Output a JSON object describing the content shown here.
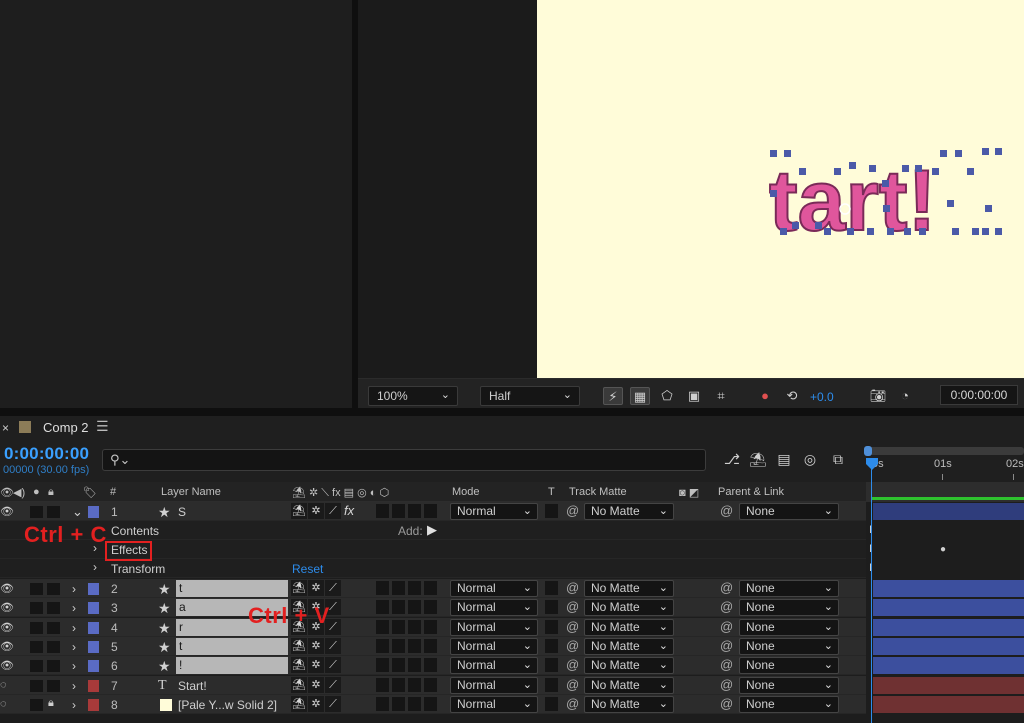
{
  "viewer": {
    "zoom": "100%",
    "resolution": "Half",
    "exposure": "+0.0",
    "timecode": "0:00:00:00",
    "comp_text": "tart!",
    "comp_text_color": "#e0569c",
    "comp_bg": "#fffcd9"
  },
  "timeline": {
    "tab_label": "Comp 2",
    "current_time": "0:00:00:00",
    "frames": "00000 (30.00 fps)",
    "search_placeholder": "",
    "ruler": [
      "0s",
      "01s",
      "02s"
    ],
    "headers": {
      "num": "#",
      "layer_name": "Layer Name",
      "mode": "Mode",
      "t": "T",
      "track_matte": "Track Matte",
      "parent": "Parent & Link"
    },
    "layer1": {
      "num": "1",
      "name": "S",
      "mode": "Normal",
      "matte": "No Matte",
      "parent": "None"
    },
    "sub": {
      "contents": "Contents",
      "add": "Add:",
      "effects": "Effects",
      "transform": "Transform",
      "reset": "Reset"
    },
    "layers": [
      {
        "num": "2",
        "name": "t",
        "mode": "Normal",
        "matte": "No Matte",
        "parent": "None",
        "color": "#5a6bc4"
      },
      {
        "num": "3",
        "name": "a",
        "mode": "Normal",
        "matte": "No Matte",
        "parent": "None",
        "color": "#5a6bc4"
      },
      {
        "num": "4",
        "name": "r",
        "mode": "Normal",
        "matte": "No Matte",
        "parent": "None",
        "color": "#5a6bc4"
      },
      {
        "num": "5",
        "name": "t",
        "mode": "Normal",
        "matte": "No Matte",
        "parent": "None",
        "color": "#5a6bc4"
      },
      {
        "num": "6",
        "name": "!",
        "mode": "Normal",
        "matte": "No Matte",
        "parent": "None",
        "color": "#5a6bc4"
      },
      {
        "num": "7",
        "name": "Start!",
        "mode": "Normal",
        "matte": "No Matte",
        "parent": "None",
        "color": "#a83a3a"
      },
      {
        "num": "8",
        "name": "[Pale Y...w Solid 2]",
        "mode": "Normal",
        "matte": "No Matte",
        "parent": "None",
        "color": "#a83a3a"
      }
    ]
  },
  "annotations": {
    "copy": "Ctrl + C",
    "paste": "Ctrl + V",
    "color": "#e32020"
  }
}
